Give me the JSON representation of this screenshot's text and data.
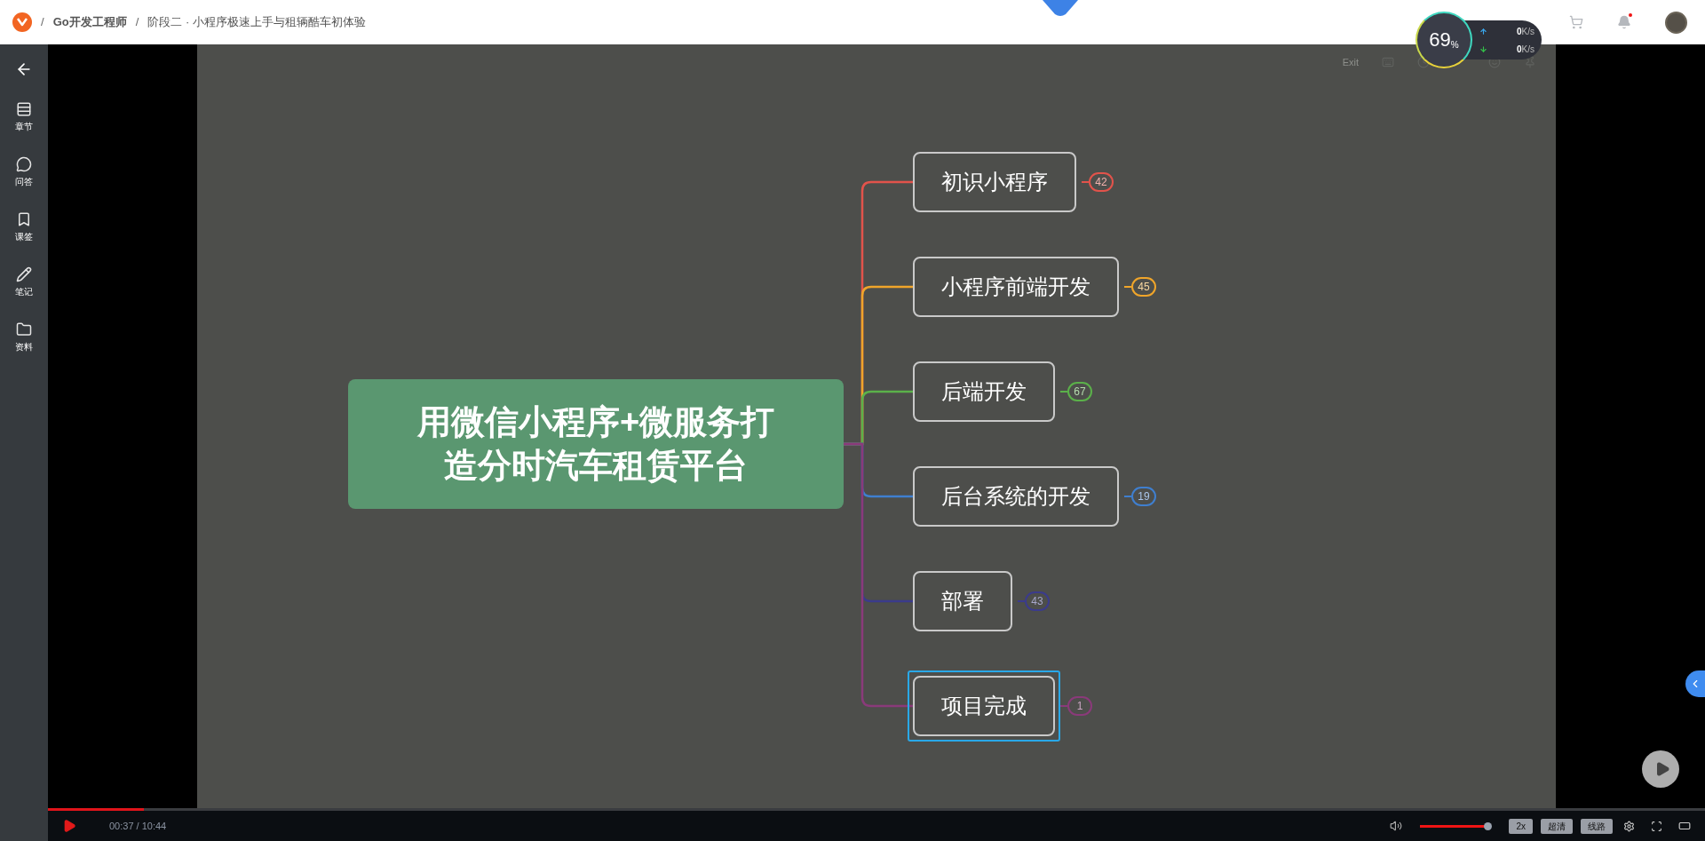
{
  "header": {
    "breadcrumb": [
      {
        "separator": "/",
        "text": "Go开发工程师",
        "bold": true
      },
      {
        "separator": "/",
        "text": "阶段二 · 小程序极速上手与租辆酷车初体验",
        "bold": false
      }
    ],
    "notifications_unread": true
  },
  "network_widget": {
    "percent": "69",
    "percent_unit": "%",
    "upload": {
      "value": "0",
      "unit": "K/s"
    },
    "download": {
      "value": "0",
      "unit": "K/s"
    }
  },
  "sidebar": {
    "items": [
      {
        "label": "章节"
      },
      {
        "label": "问答"
      },
      {
        "label": "课签"
      },
      {
        "label": "笔记"
      },
      {
        "label": "资料"
      }
    ]
  },
  "slide_toolbar": {
    "exit_label": "Exit"
  },
  "mindmap": {
    "root": "用微信小程序+微服务打造分时汽车租赁平台",
    "branches": [
      {
        "label": "初识小程序",
        "count": "42",
        "color": "#e2534b",
        "selected": false
      },
      {
        "label": "小程序前端开发",
        "count": "45",
        "color": "#f0a52a",
        "selected": false
      },
      {
        "label": "后端开发",
        "count": "67",
        "color": "#5bb14a",
        "selected": false
      },
      {
        "label": "后台系统的开发",
        "count": "19",
        "color": "#3f7fcf",
        "selected": false
      },
      {
        "label": "部署",
        "count": "43",
        "color": "#3b3b8c",
        "selected": false
      },
      {
        "label": "项目完成",
        "count": "1",
        "color": "#8a3a7a",
        "selected": true
      }
    ]
  },
  "player": {
    "time": "00:37 / 10:44",
    "progress": {
      "level": 0.058
    },
    "volume": {
      "level": 1.0
    },
    "buttons": [
      "2x",
      "超清",
      "线路"
    ]
  }
}
